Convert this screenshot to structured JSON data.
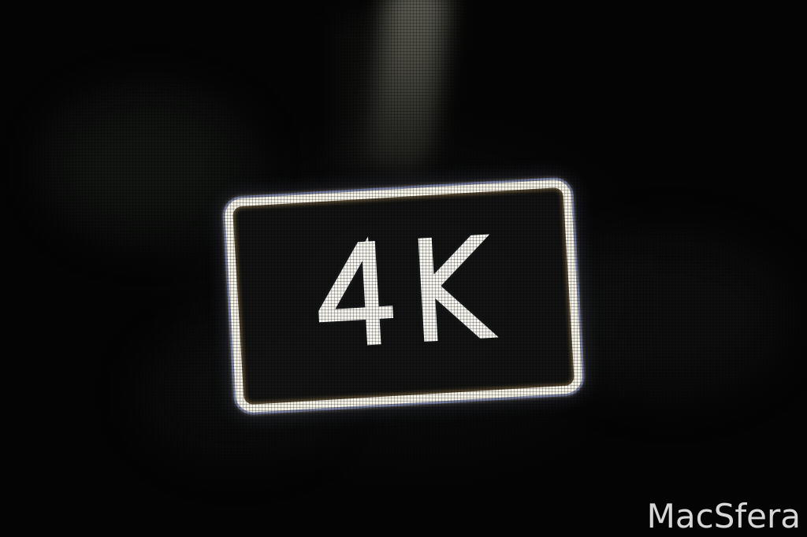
{
  "badge": {
    "label": "4K"
  },
  "watermark": {
    "text": "MacSfera"
  },
  "colors": {
    "background": "#050505",
    "badge_outline": "#f4f1e6",
    "badge_text": "#f6f4ee",
    "fringe_blue": "#5a78ff",
    "fringe_warm": "#ffc878"
  }
}
